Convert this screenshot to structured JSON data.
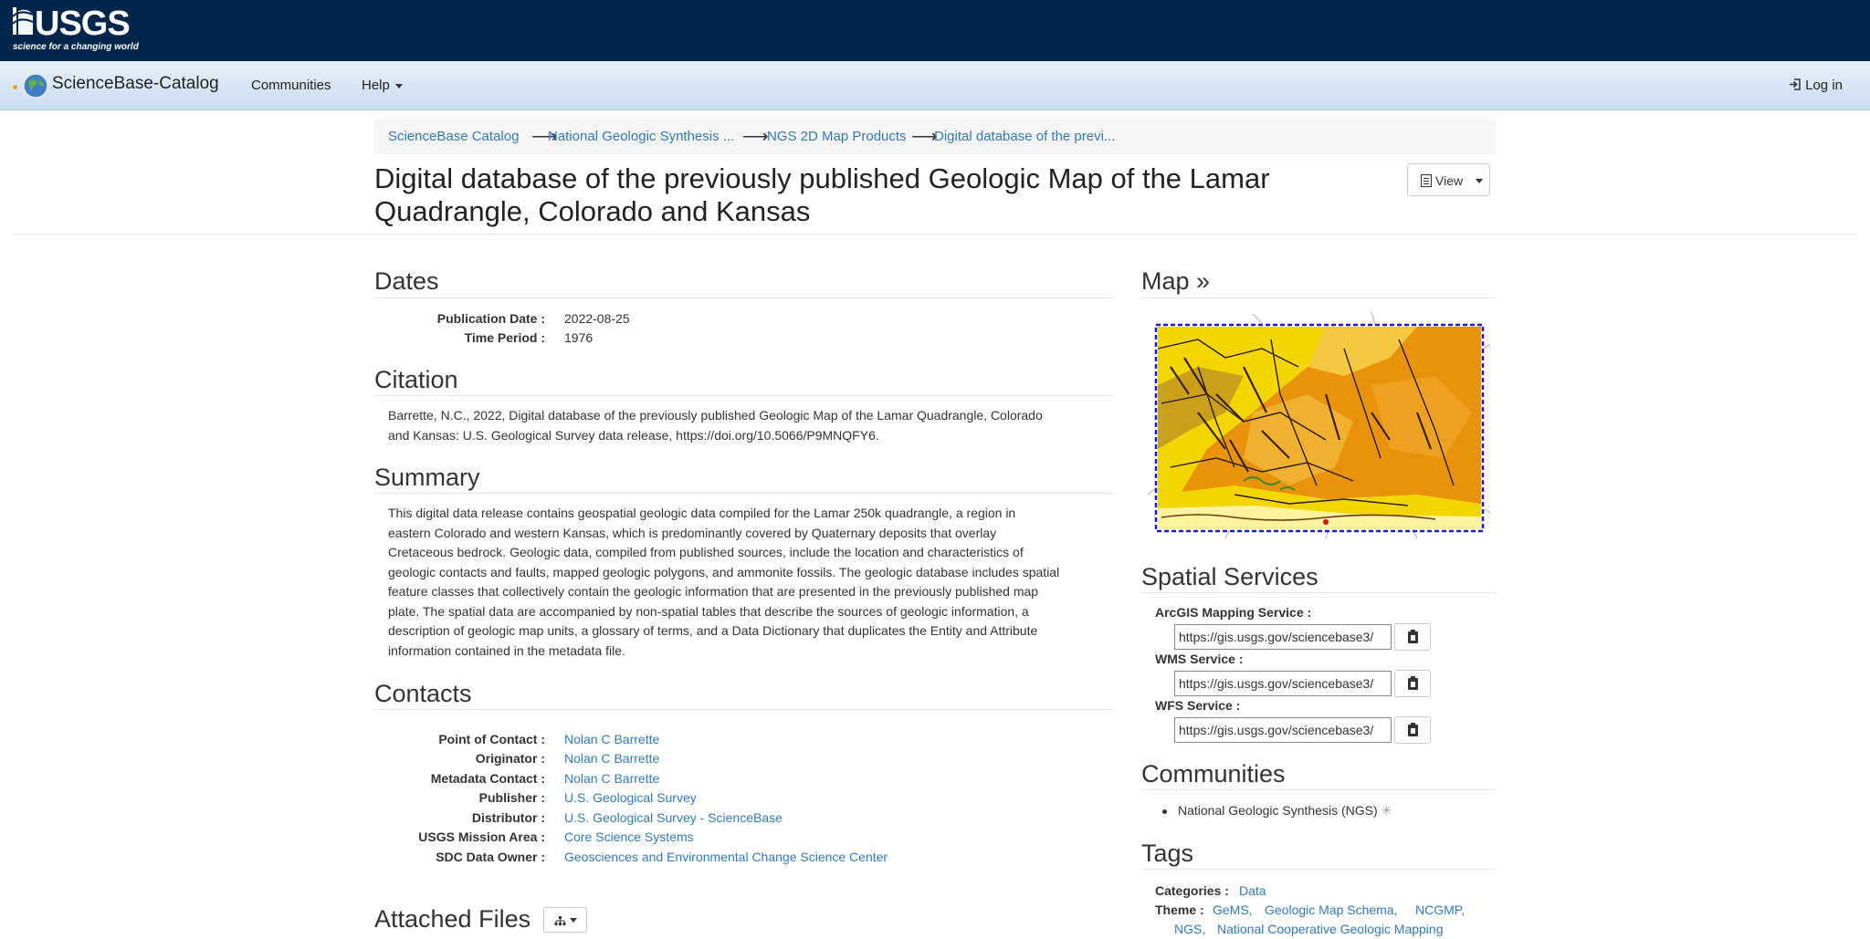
{
  "header": {
    "logo_text": "USGS",
    "logo_tagline": "science for a changing world"
  },
  "nav": {
    "brand": "ScienceBase-Catalog",
    "communities": "Communities",
    "help": "Help",
    "login": "Log in"
  },
  "breadcrumb": [
    "ScienceBase Catalog",
    "National Geologic Synthesis ...",
    "NGS 2D Map Products",
    "Digital database of the previ..."
  ],
  "breadcrumb_arrow": "⟶",
  "title_line1": "Digital database of the previously published Geologic Map of the Lamar",
  "title_line2": "Quadrangle, Colorado and Kansas",
  "view_button": "View",
  "dates": {
    "heading": "Dates",
    "rows": [
      {
        "label": "Publication Date :",
        "value": "2022-08-25"
      },
      {
        "label": "Time Period :",
        "value": "1976"
      }
    ]
  },
  "citation": {
    "heading": "Citation",
    "line1": "Barrette, N.C., 2022, Digital database of the previously published Geologic Map of the Lamar Quadrangle, Colorado",
    "line2": "and Kansas: U.S. Geological Survey data release, https://doi.org/10.5066/P9MNQFY6."
  },
  "summary": {
    "heading": "Summary",
    "lines": [
      "This digital data release contains geospatial geologic data compiled for the Lamar 250k quadrangle, a region in",
      "eastern Colorado and western Kansas, which is predominantly covered by Quaternary deposits that overlay",
      "Cretaceous bedrock. Geologic data, compiled from published sources, include the location and characteristics of",
      "geologic contacts and faults, mapped geologic polygons, and ammonite fossils. The geologic database includes spatial",
      "feature classes that collectively contain the geologic information that are presented in the previously published map",
      "plate. The spatial data are accompanied by non-spatial tables that describe the sources of geologic information, a",
      "description of geologic map units, a glossary of terms, and a Data Dictionary that duplicates the Entity and Attribute",
      "information contained in the metadata file."
    ]
  },
  "contacts": {
    "heading": "Contacts",
    "rows": [
      {
        "label": "Point of Contact :",
        "value": "Nolan C Barrette"
      },
      {
        "label": "Originator :",
        "value": "Nolan C Barrette"
      },
      {
        "label": "Metadata Contact :",
        "value": "Nolan C Barrette"
      },
      {
        "label": "Publisher :",
        "value": "U.S. Geological Survey"
      },
      {
        "label": "Distributor :",
        "value": "U.S. Geological Survey - ScienceBase"
      },
      {
        "label": "USGS Mission Area :",
        "value": "Core Science Systems"
      },
      {
        "label": "SDC Data Owner :",
        "value": "Geosciences and Environmental Change Science Center"
      }
    ]
  },
  "attached_files": {
    "heading": "Attached Files"
  },
  "map": {
    "heading": "Map »"
  },
  "spatial_services": {
    "heading": "Spatial Services",
    "services": [
      {
        "label": "ArcGIS Mapping Service :",
        "url": "https://gis.usgs.gov/sciencebase3/"
      },
      {
        "label": "WMS Service :",
        "url": "https://gis.usgs.gov/sciencebase3/"
      },
      {
        "label": "WFS Service :",
        "url": "https://gis.usgs.gov/sciencebase3/"
      }
    ]
  },
  "communities": {
    "heading": "Communities",
    "items": [
      "National Geologic Synthesis (NGS)"
    ]
  },
  "tags": {
    "heading": "Tags",
    "categories_label": "Categories :",
    "categories": [
      "Data"
    ],
    "theme_label": "Theme :",
    "theme": [
      "GeMS,",
      "Geologic Map Schema,",
      "NCGMP,",
      "NGS,",
      "National Cooperative Geologic Mapping"
    ]
  },
  "colors": {
    "usgs_blue": "#00264c",
    "link": "#337ab7",
    "map_yellow": "#f2d600",
    "map_orange": "#e8930a",
    "map_border": "#1a1adb"
  }
}
